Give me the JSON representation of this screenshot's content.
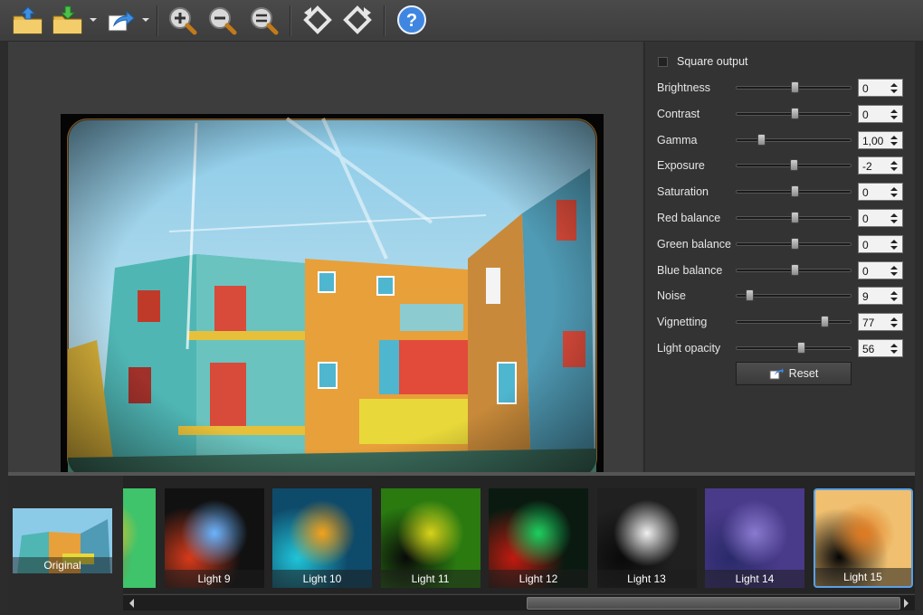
{
  "toolbar": {
    "buttons": [
      {
        "name": "open-icon"
      },
      {
        "name": "save-icon"
      },
      {
        "name": "share-icon"
      },
      {
        "name": "zoom-in-icon"
      },
      {
        "name": "zoom-out-icon"
      },
      {
        "name": "zoom-fit-icon"
      },
      {
        "name": "rotate-left-icon"
      },
      {
        "name": "rotate-right-icon"
      },
      {
        "name": "help-icon"
      }
    ]
  },
  "panel": {
    "square_output_label": "Square output",
    "sliders": [
      {
        "label": "Brightness",
        "value": "0",
        "level": 0.5
      },
      {
        "label": "Contrast",
        "value": "0",
        "level": 0.5
      },
      {
        "label": "Gamma",
        "value": "1,00",
        "level": 0.2
      },
      {
        "label": "Exposure",
        "value": "-2",
        "level": 0.49
      },
      {
        "label": "Saturation",
        "value": "0",
        "level": 0.5
      },
      {
        "label": "Red balance",
        "value": "0",
        "level": 0.5
      },
      {
        "label": "Green balance",
        "value": "0",
        "level": 0.5
      },
      {
        "label": "Blue balance",
        "value": "0",
        "level": 0.5
      },
      {
        "label": "Noise",
        "value": "9",
        "level": 0.09
      },
      {
        "label": "Vignetting",
        "value": "77",
        "level": 0.77
      },
      {
        "label": "Light opacity",
        "value": "56",
        "level": 0.56
      }
    ],
    "reset_label": "Reset"
  },
  "filmstrip": {
    "original_label": "Original",
    "items": [
      {
        "label": "",
        "colors": [
          "#d84c1e",
          "#f4c326",
          "#3fc36b"
        ]
      },
      {
        "label": "Light 9",
        "colors": [
          "#d63a1a",
          "#6ab4ff",
          "#111111"
        ]
      },
      {
        "label": "Light 10",
        "colors": [
          "#20c4d8",
          "#f4a21a",
          "#0e4a6a"
        ]
      },
      {
        "label": "Light 11",
        "colors": [
          "#0a0a0a",
          "#d8d21a",
          "#2a7a10"
        ]
      },
      {
        "label": "Light 12",
        "colors": [
          "#c01a10",
          "#1ad060",
          "#0a1a10"
        ]
      },
      {
        "label": "Light 13",
        "colors": [
          "#0a0a0a",
          "#f0f0f0",
          "#202020"
        ]
      },
      {
        "label": "Light 14",
        "colors": [
          "#2a2a6a",
          "#8a7ad0",
          "#4a3a8a"
        ]
      },
      {
        "label": "Light 15",
        "colors": [
          "#050505",
          "#e07a20",
          "#f0c070"
        ],
        "selected": true
      }
    ]
  },
  "colors": {
    "accent": "#5aa0e6",
    "panel_bg": "#333333",
    "toolbar_bg": "#444444"
  }
}
